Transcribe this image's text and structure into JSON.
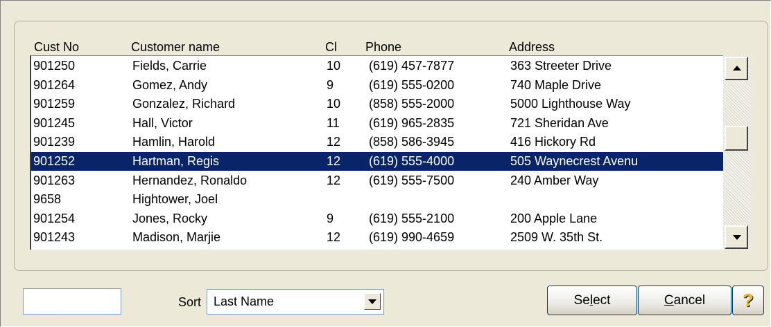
{
  "columns": {
    "cust_no": "Cust No",
    "customer_name": "Customer name",
    "cl": "Cl",
    "phone": "Phone",
    "address": "Address"
  },
  "rows": [
    {
      "cust_no": "901250",
      "name": "Fields, Carrie",
      "cl": "10",
      "phone": "(619) 457-7877",
      "address": "363 Streeter Drive"
    },
    {
      "cust_no": "901264",
      "name": "Gomez, Andy",
      "cl": "9",
      "phone": "(619) 555-0200",
      "address": "740 Maple Drive"
    },
    {
      "cust_no": "901259",
      "name": "Gonzalez, Richard",
      "cl": "10",
      "phone": "(858) 555-2000",
      "address": "5000 Lighthouse Way"
    },
    {
      "cust_no": "901245",
      "name": "Hall, Victor",
      "cl": "11",
      "phone": "(619) 965-2835",
      "address": "721 Sheridan Ave"
    },
    {
      "cust_no": "901239",
      "name": "Hamlin, Harold",
      "cl": "12",
      "phone": "(858) 586-3945",
      "address": "416 Hickory Rd"
    },
    {
      "cust_no": "901252",
      "name": "Hartman, Regis",
      "cl": "12",
      "phone": "(619) 555-4000",
      "address": "505 Waynecrest Avenu",
      "selected": true
    },
    {
      "cust_no": "901263",
      "name": "Hernandez, Ronaldo",
      "cl": "12",
      "phone": "(619) 555-7500",
      "address": "240 Amber Way"
    },
    {
      "cust_no": "9658",
      "name": "Hightower, Joel",
      "cl": "",
      "phone": "",
      "address": ""
    },
    {
      "cust_no": "901254",
      "name": "Jones, Rocky",
      "cl": "9",
      "phone": "(619) 555-2100",
      "address": "200 Apple Lane"
    },
    {
      "cust_no": "901243",
      "name": "Madison, Marjie",
      "cl": "12",
      "phone": "(619) 990-4659",
      "address": "2509 W. 35th St."
    }
  ],
  "search": {
    "value": ""
  },
  "sort": {
    "label": "Sort",
    "value": "Last Name"
  },
  "buttons": {
    "select_pre": "Se",
    "select_u": "l",
    "select_post": "ect",
    "cancel_u": "C",
    "cancel_post": "ancel",
    "help_glyph": "?"
  },
  "colors": {
    "selection": "#0a246a",
    "background": "#ece9d8"
  }
}
